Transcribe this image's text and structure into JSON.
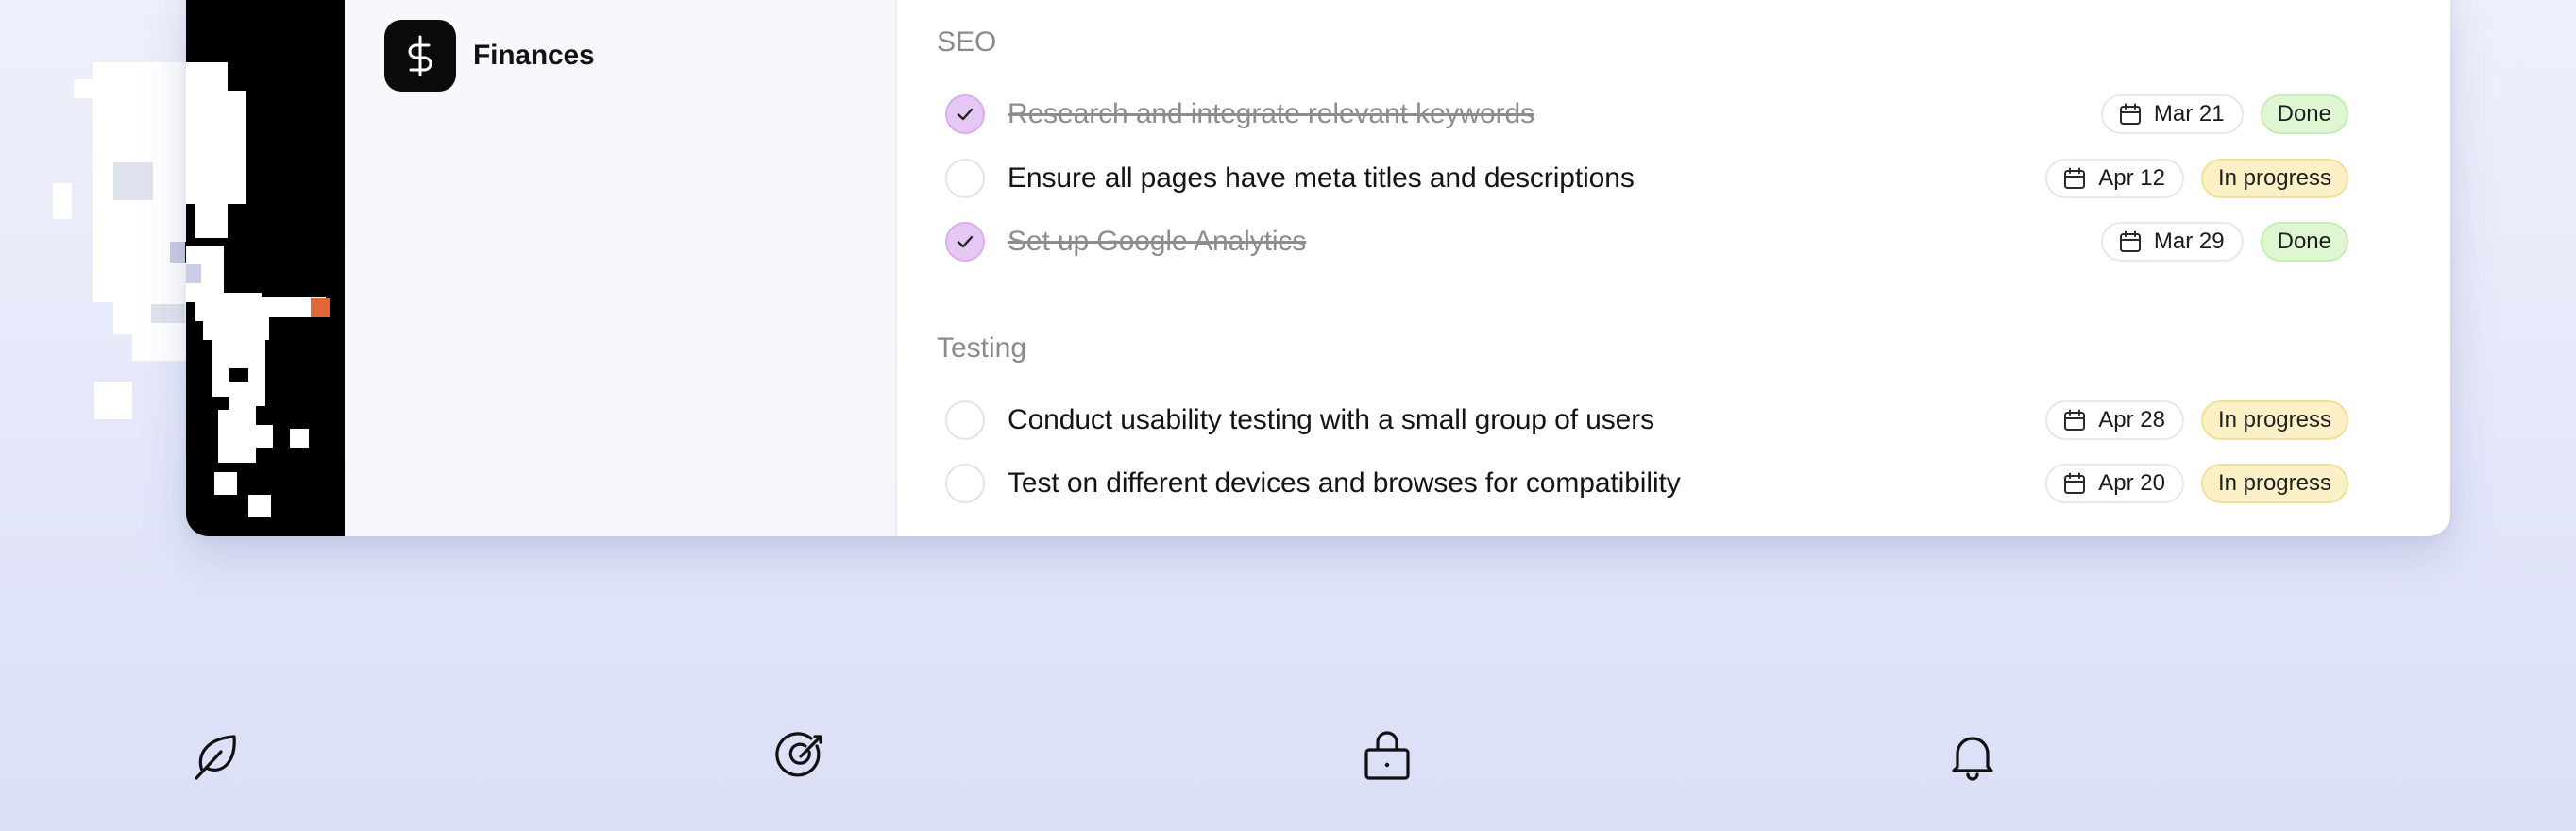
{
  "sidebar": {
    "project": {
      "label": "Finances",
      "icon": "dollar-icon"
    }
  },
  "sections": [
    {
      "title": "SEO",
      "tasks": [
        {
          "text": "Research and integrate relevant keywords",
          "done": true,
          "date": "Mar 21",
          "status": "Done"
        },
        {
          "text": "Ensure all pages have meta titles and descriptions",
          "done": false,
          "date": "Apr 12",
          "status": "In progress"
        },
        {
          "text": "Set up Google Analytics",
          "done": true,
          "date": "Mar 29",
          "status": "Done"
        }
      ]
    },
    {
      "title": "Testing",
      "tasks": [
        {
          "text": "Conduct usability testing with a small group of users",
          "done": false,
          "date": "Apr 28",
          "status": "In progress"
        },
        {
          "text": "Test on different devices and browses for compatibility",
          "done": false,
          "date": "Apr 20",
          "status": "In progress"
        }
      ]
    }
  ],
  "bottom_icons": [
    "leaf-icon",
    "target-icon",
    "lock-icon",
    "bell-icon"
  ],
  "colors": {
    "checked_fill": "#e6c8f4",
    "done_badge": "#def7d2",
    "progress_badge": "#fbf0c6",
    "background": "#e4e7f9"
  }
}
